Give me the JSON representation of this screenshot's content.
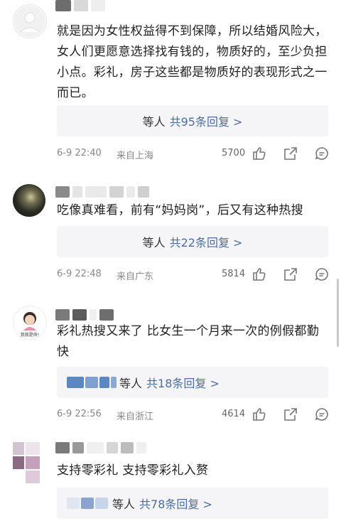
{
  "comments": [
    {
      "text": "就是因为女性权益得不到保障，所以结婚风险大，女人们更愿意选择找有钱的，物质好的，至少负担小点。彩礼，房子这些都是物质好的表现形式之一而已。",
      "reply_prefix": "等人",
      "reply_link": "共95条回复 >",
      "time": "6-9 22:40",
      "location": "来自上海",
      "likes": "5700"
    },
    {
      "text": "吃像真难看，前有“妈妈岗”，后又有这种热搜",
      "reply_prefix": "等人",
      "reply_link": "共22条回复 >",
      "time": "6-9 22:48",
      "location": "来自广东",
      "likes": "5814"
    },
    {
      "text": "彩礼热搜又来了 比女生一个月来一次的例假都勤快",
      "reply_prefix": "等人",
      "reply_link": "共18条回复 >",
      "time": "6-9 22:56",
      "location": "来自浙江",
      "likes": "4614",
      "avatar_caption": "我就是命!"
    },
    {
      "text": "支持零彩礼 支持零彩礼入赘",
      "reply_prefix": "等人",
      "reply_link": "共78条回复 >"
    }
  ],
  "icons": [
    "like-icon",
    "share-icon",
    "comment-icon"
  ],
  "colors": {
    "link": "#4a6ea9",
    "meta": "#888888",
    "reply_bg": "#f5f5f7"
  }
}
